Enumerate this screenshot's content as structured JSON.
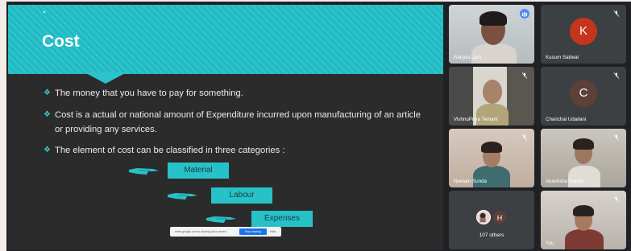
{
  "slide": {
    "title": "Cost",
    "bullets": [
      "The money that you have to pay for something.",
      "Cost is a actual or national amount of Expenditure incurred upon manufacturing of an article or providing any services.",
      "The element of cost can be classified in three categories :"
    ],
    "bullet_mark": "❖",
    "flow": [
      "Material",
      "Labour",
      "Expenses"
    ],
    "accent_color": "#27c2c8"
  },
  "share_banner": {
    "message": "meet.google.com is sharing your screen.",
    "stop_label": "Stop sharing",
    "hide_label": "Hide"
  },
  "participants": [
    {
      "name": "Ranjula Jain",
      "type": "video",
      "speaking": true
    },
    {
      "name": "Kusum Satiwal",
      "type": "avatar",
      "initial": "K",
      "color": "#c5351d"
    },
    {
      "name": "VishnuPriya Temani",
      "type": "video"
    },
    {
      "name": "Chanchal Udailani",
      "type": "avatar",
      "initial": "C",
      "color": "#5d4037"
    },
    {
      "name": "Neelam Sunda",
      "type": "video"
    },
    {
      "name": "Akanksha Ganda",
      "type": "video"
    },
    {
      "name": "107 others",
      "type": "others",
      "initial": "H",
      "color": "#5d4037"
    },
    {
      "name": "You",
      "type": "video"
    }
  ],
  "icons": {
    "mic_muted": "mic-off-icon",
    "speaking": "audio-level-icon",
    "hand": "pointing-hand-icon"
  }
}
